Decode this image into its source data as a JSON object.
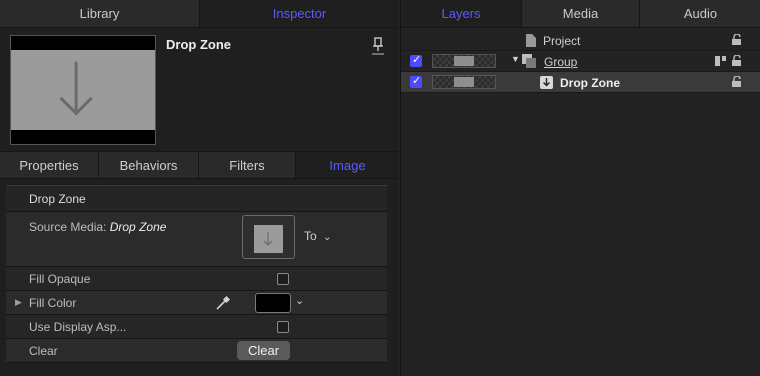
{
  "left_tabs": [
    "Library",
    "Inspector"
  ],
  "right_tabs": [
    "Layers",
    "Media",
    "Audio"
  ],
  "inspector": {
    "title": "Drop Zone",
    "subtabs": [
      "Properties",
      "Behaviors",
      "Filters",
      "Image"
    ],
    "section_title": "Drop Zone",
    "source_media_label": "Source Media:",
    "source_media_value": "Drop Zone",
    "to_label": "To",
    "fill_opaque_label": "Fill Opaque",
    "fill_color_label": "Fill Color",
    "fill_color_value": "#000000",
    "use_display_label": "Use Display Asp...",
    "clear_label": "Clear",
    "clear_button": "Clear"
  },
  "layers": {
    "project": "Project",
    "group": "Group",
    "drop_zone": "Drop Zone"
  },
  "colors": {
    "accent": "#5b5bff",
    "checkbox": "#4b4bff"
  }
}
